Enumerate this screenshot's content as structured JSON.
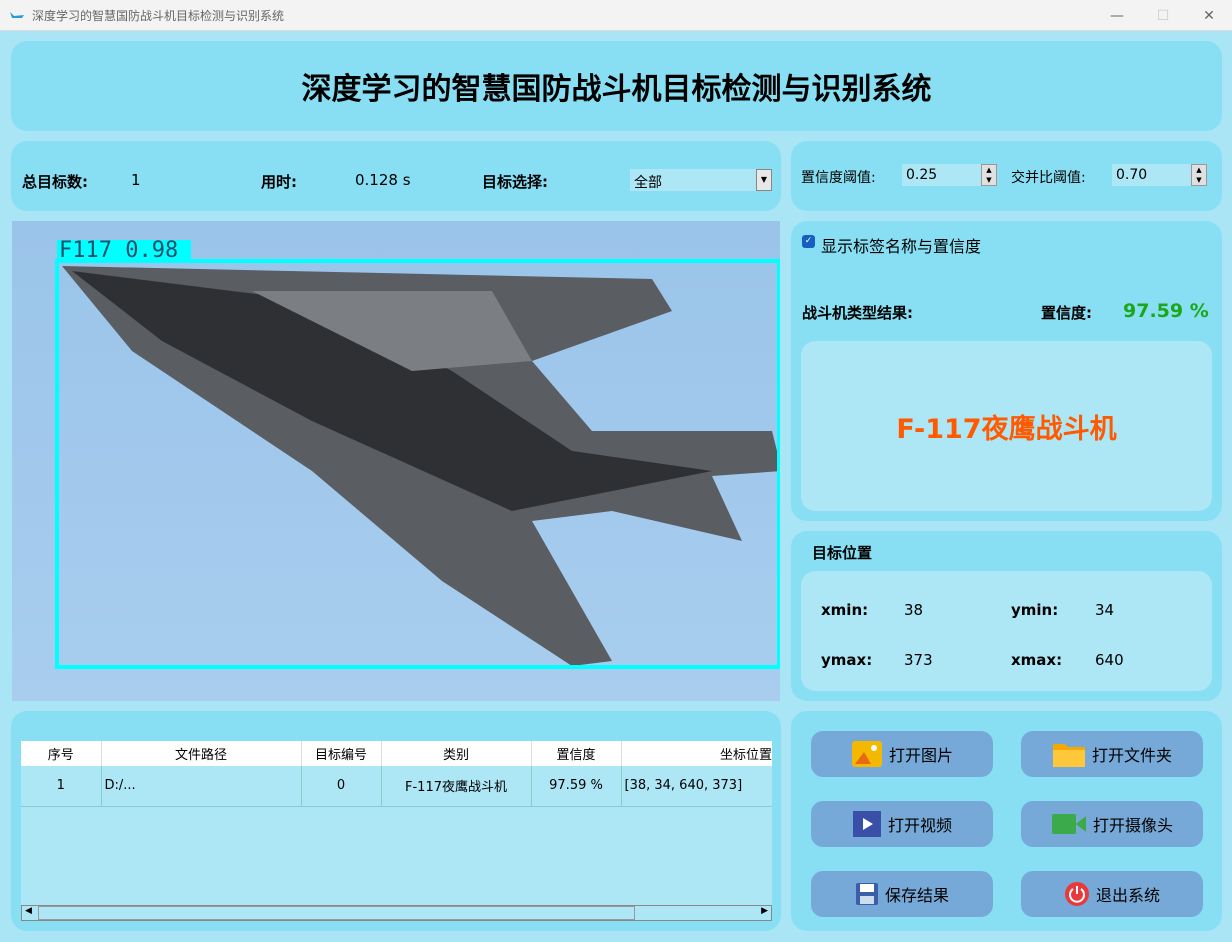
{
  "window": {
    "title": "深度学习的智慧国防战斗机目标检测与识别系统"
  },
  "header": {
    "title": "深度学习的智慧国防战斗机目标检测与识别系统"
  },
  "stats": {
    "total_label": "总目标数:",
    "total_value": "1",
    "time_label": "用时:",
    "time_value": "0.128 s",
    "select_label": "目标选择:",
    "select_value": "全部"
  },
  "thresholds": {
    "conf_label": "置信度阈值:",
    "conf_value": "0.25",
    "iou_label": "交并比阈值:",
    "iou_value": "0.70"
  },
  "display": {
    "checkbox_label": "显示标签名称与置信度",
    "checked": true
  },
  "detection": {
    "box_label": "F117 0.98",
    "result_label": "战斗机类型结果:",
    "conf_label": "置信度:",
    "conf_value": "97.59 %",
    "result_value": "F-117夜鹰战斗机",
    "colors": {
      "conf": "#1aa81a",
      "result": "#ff5a00",
      "box": "#00ffff"
    }
  },
  "position": {
    "title": "目标位置",
    "xmin_label": "xmin:",
    "xmin": "38",
    "ymin_label": "ymin:",
    "ymin": "34",
    "ymax_label": "ymax:",
    "ymax": "373",
    "xmax_label": "xmax:",
    "xmax": "640"
  },
  "table": {
    "headers": [
      "序号",
      "文件路径",
      "目标编号",
      "类别",
      "置信度",
      "坐标位置"
    ],
    "rows": [
      [
        "1",
        "D:/...",
        "0",
        "F-117夜鹰战斗机",
        "97.59 %",
        "[38, 34, 640, 373]"
      ]
    ]
  },
  "buttons": {
    "open_image": "打开图片",
    "open_folder": "打开文件夹",
    "open_video": "打开视频",
    "open_camera": "打开摄像头",
    "save": "保存结果",
    "exit": "退出系统"
  }
}
